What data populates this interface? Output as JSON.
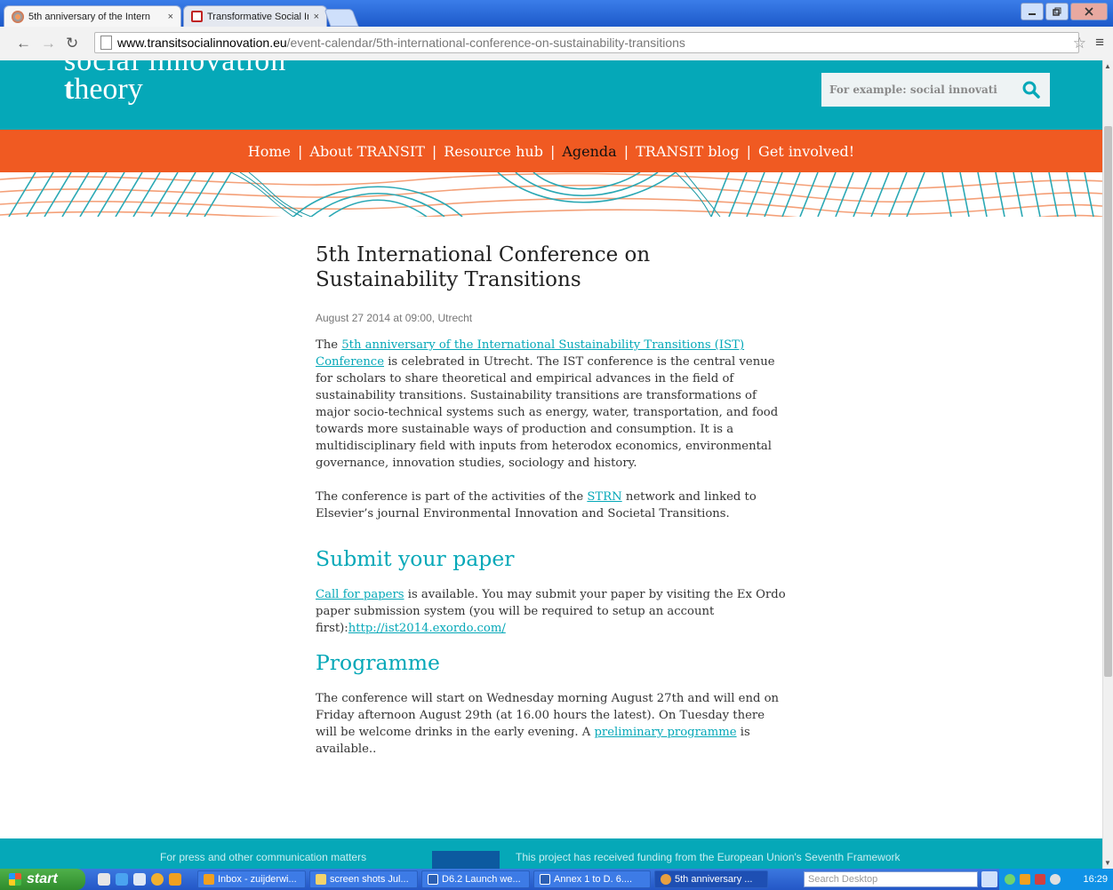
{
  "browser": {
    "tabs": [
      {
        "title": "5th anniversary of the Intern",
        "active": true
      },
      {
        "title": "Transformative Social Innova",
        "active": false
      }
    ],
    "close_glyph": "×",
    "url_host": "www.transitsocialinnovation.eu",
    "url_path": "/event-calendar/5th-international-conference-on-sustainability-transitions"
  },
  "site": {
    "logo_top": "social innovation",
    "logo_bottom_bold": "t",
    "logo_bottom_rest": "heory",
    "search_placeholder": "For example: social innovati",
    "nav": [
      {
        "label": "Home"
      },
      {
        "label": "About TRANSIT"
      },
      {
        "label": "Resource hub"
      },
      {
        "label": "Agenda",
        "current": true
      },
      {
        "label": "TRANSIT blog"
      },
      {
        "label": "Get involved!"
      }
    ],
    "nav_separator": "|",
    "colors": {
      "teal": "#05a8b8",
      "orange": "#f05a22"
    }
  },
  "article": {
    "title": "5th International Conference on Sustainability Transitions",
    "meta": "August 27 2014 at 09:00, Utrecht",
    "p1_before": "The ",
    "p1_link": "5th anniversary of the International Sustainability Transitions (IST) Conference",
    "p1_after": " is celebrated in Utrecht. The IST conference is the central venue for scholars to share theoretical and empirical advances in the field of sustainability transitions. Sustainability transitions are transformations of major socio-technical systems such as energy, water, transportation, and food towards more sustainable ways of production and consumption. It is a multidisciplinary field with inputs from heterodox economics, environmental governance, innovation studies, sociology and history.",
    "p2_before": "The conference is part of the activities of the ",
    "p2_link": "STRN",
    "p2_after": " network and linked to Elsevier’s journal Environmental Innovation and Societal Transitions.",
    "h_submit": "Submit your paper",
    "p3_link1": "Call for papers",
    "p3_mid": " is available. You may submit your paper by visiting the Ex Ordo paper submission system (you will be required to setup an account first):",
    "p3_link2": "http://ist2014.exordo.com/",
    "h_programme": "Programme",
    "p4_before": "The conference will start on Wednesday morning August 27th and will end on Friday afternoon August 29th (at 16.00 hours the latest). On Tuesday there will be welcome drinks in the early evening. A ",
    "p4_link": "preliminary programme",
    "p4_after": " is available.."
  },
  "footer": {
    "left": "For press and other communication matters",
    "right": "This project has received funding from the European Union's Seventh Framework"
  },
  "taskbar": {
    "start": "start",
    "tasks": [
      {
        "label": "Inbox - zuijderwi...",
        "color": "#f0a020"
      },
      {
        "label": "screen shots Jul...",
        "color": "#f3d36b"
      },
      {
        "label": "D6.2 Launch we...",
        "color": "#2b5fb3"
      },
      {
        "label": "Annex 1 to D. 6....",
        "color": "#2b5fb3"
      },
      {
        "label": "5th anniversary ...",
        "color": "#e8a040"
      }
    ],
    "search_placeholder": "Search Desktop",
    "clock": "16:29"
  }
}
